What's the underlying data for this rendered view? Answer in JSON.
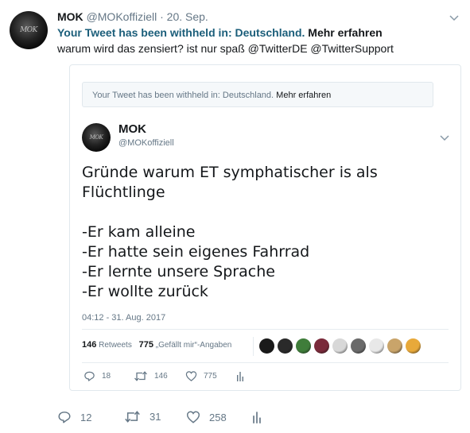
{
  "tweet": {
    "name": "MOK",
    "handle": "@MOKoffiziell",
    "separator": "·",
    "date": "20. Sep.",
    "withheld_text": "Your Tweet has been withheld in: Deutschland.",
    "withheld_link": "Mehr erfahren",
    "text": "warum wird das zensiert? ist nur spaß @TwitterDE @TwitterSupport",
    "avatar_icon": "mok-logo-avatar",
    "actions": {
      "replies": "12",
      "retweets": "31",
      "likes": "258"
    }
  },
  "quoted": {
    "withheld_text": "Your Tweet has been withheld in: Deutschland.",
    "withheld_link": "Mehr erfahren",
    "name": "MOK",
    "handle": "@MOKoffiziell",
    "body_lines": [
      "Gründe warum ET symphatischer is als",
      "Flüchtlinge",
      "",
      "-Er kam alleine",
      "-Er hatte sein eigenes Fahrrad",
      "-Er lernte unsere Sprache",
      "-Er wollte zurück"
    ],
    "timestamp": "04:12 - 31. Aug. 2017",
    "retweets_count": "146",
    "retweets_label": "Retweets",
    "likes_count": "775",
    "likes_label": "„Gefällt mir“-Angaben",
    "liker_avatar_colors": [
      "#1a1a1a",
      "#2a2a2a",
      "#3f7d3a",
      "#7a2a3a",
      "#d8d8d8",
      "#6a6a6a",
      "#e8e8e8",
      "#c9a46a",
      "#e8a93a"
    ],
    "actions": {
      "replies": "18",
      "retweets": "146",
      "likes": "775"
    }
  },
  "colors": {
    "withheld_text": "#1b5e7a",
    "muted": "#657786",
    "border": "#e1e8ed"
  }
}
